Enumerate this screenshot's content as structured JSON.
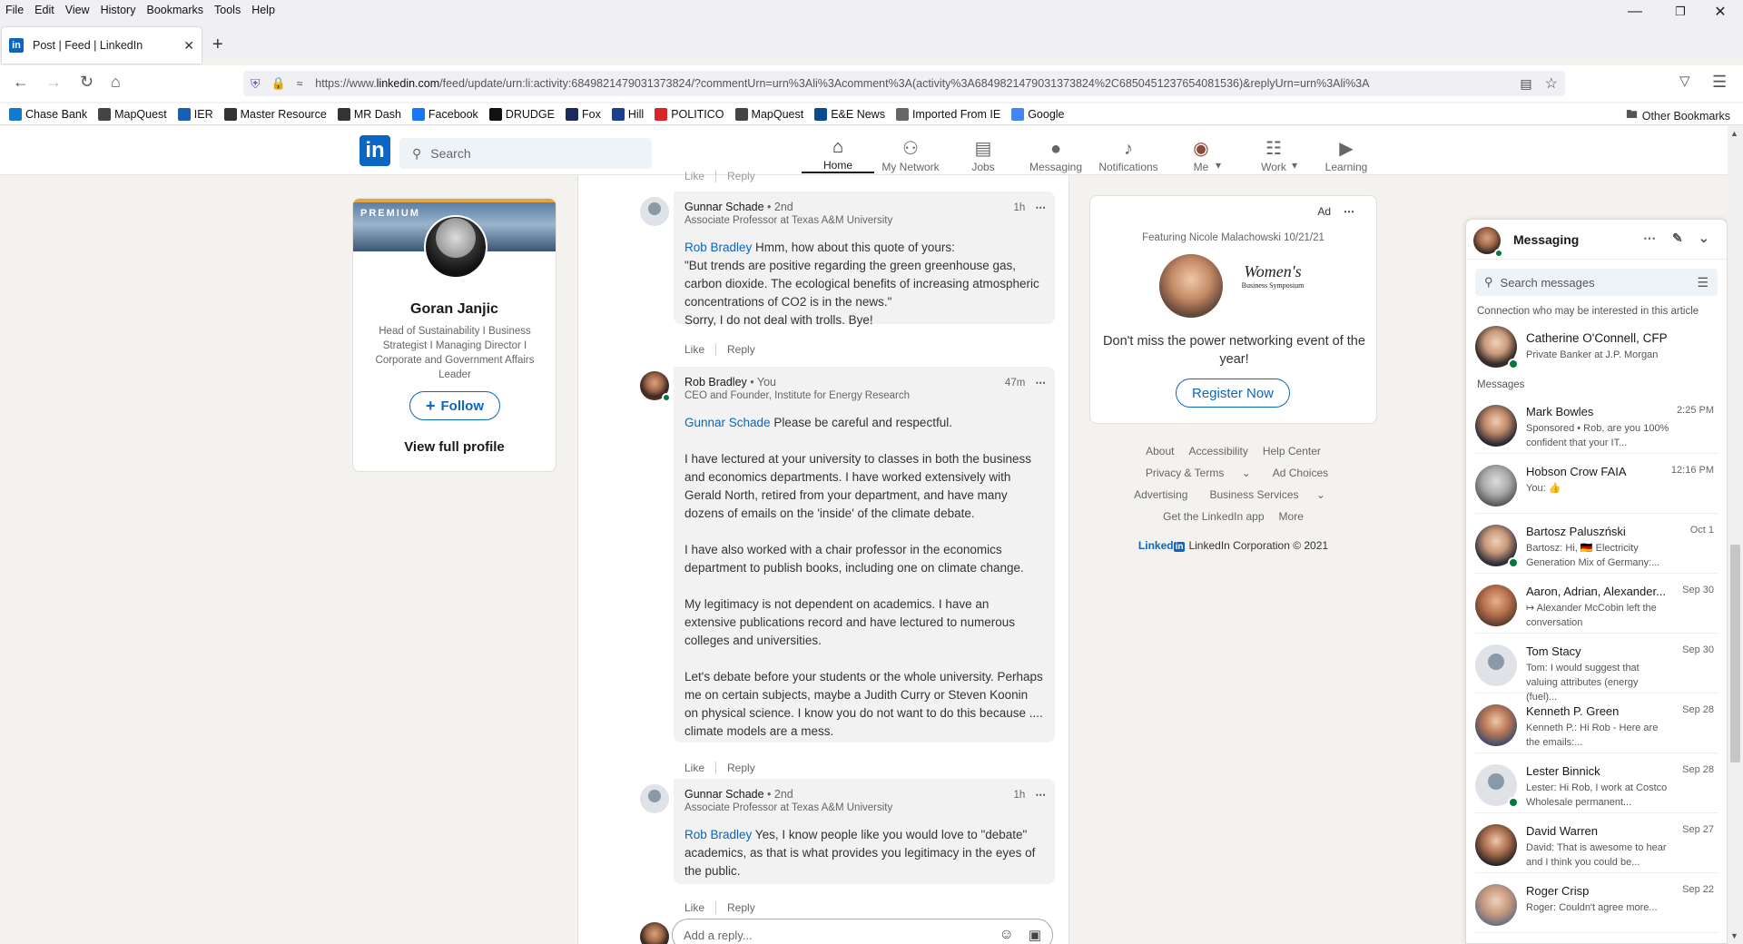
{
  "browser": {
    "menu": [
      "File",
      "Edit",
      "View",
      "History",
      "Bookmarks",
      "Tools",
      "Help"
    ],
    "tab_title": "Post | Feed | LinkedIn",
    "url_prefix": "https://www.",
    "url_domain": "linkedin.com",
    "url_rest": "/feed/update/urn:li:activity:6849821479031373824/?commentUrn=urn%3Ali%3Acomment%3A(activity%3A6849821479031373824%2C6850451237654081536)&replyUrn=urn%3Ali%3A",
    "bookmarks": [
      {
        "label": "Chase Bank",
        "icon": "chase-icon",
        "color": "#117aca"
      },
      {
        "label": "MapQuest",
        "icon": "folder-map-icon",
        "color": "#444"
      },
      {
        "label": "IER",
        "icon": "ier-icon",
        "color": "#1a5fb4"
      },
      {
        "label": "Master Resource",
        "icon": "mr-icon",
        "color": "#333"
      },
      {
        "label": "MR Dash",
        "icon": "mr-icon",
        "color": "#333"
      },
      {
        "label": "Facebook",
        "icon": "facebook-icon",
        "color": "#1877f2"
      },
      {
        "label": "DRUDGE",
        "icon": "drudge-icon",
        "color": "#111"
      },
      {
        "label": "Fox",
        "icon": "fox-icon",
        "color": "#1b2b5a"
      },
      {
        "label": "Hill",
        "icon": "hill-icon",
        "color": "#1c3f8c"
      },
      {
        "label": "POLITICO",
        "icon": "politico-icon",
        "color": "#d7262a"
      },
      {
        "label": "MapQuest",
        "icon": "folder-map-icon",
        "color": "#444"
      },
      {
        "label": "E&E News",
        "icon": "ee-icon",
        "color": "#0b4a8f"
      },
      {
        "label": "Imported From IE",
        "icon": "folder-icon",
        "color": "#666"
      },
      {
        "label": "Google",
        "icon": "google-icon",
        "color": "#4285f4"
      }
    ],
    "other_bookmarks": "Other Bookmarks"
  },
  "linkedin": {
    "search_placeholder": "Search",
    "nav": [
      {
        "label": "Home",
        "icon": "home-icon",
        "active": true
      },
      {
        "label": "My Network",
        "icon": "network-icon"
      },
      {
        "label": "Jobs",
        "icon": "jobs-icon"
      },
      {
        "label": "Messaging",
        "icon": "messaging-icon"
      },
      {
        "label": "Notifications",
        "icon": "bell-icon"
      },
      {
        "label": "Me",
        "icon": "avatar"
      },
      {
        "label": "Work",
        "icon": "grid-icon"
      },
      {
        "label": "Learning",
        "icon": "learning-icon"
      }
    ]
  },
  "profile": {
    "badge": "PREMIUM",
    "name": "Goran Janjic",
    "headline": "Head of Sustainability I Business Strategist I Managing Director I Corporate and Government Affairs Leader",
    "follow_label": "Follow",
    "view_full": "View full profile"
  },
  "comments": [
    {
      "author": "Gunnar Schade",
      "degree": "• 2nd",
      "subtitle": "Associate Professor at Texas A&M University",
      "time": "1h",
      "mention": "Rob Bradley",
      "text": " Hmm, how about this quote of yours:\n\"But trends are positive regarding the green greenhouse gas, carbon dioxide. The ecological benefits of increasing atmospheric concentrations of CO2 is in the news.\"\nSorry, I do not deal with trolls. Bye!"
    },
    {
      "author": "Rob Bradley",
      "degree": "• You",
      "subtitle": "CEO and Founder, Institute for Energy Research",
      "time": "47m",
      "mention": "Gunnar Schade",
      "text": " Please be careful and respectful.\n\nI have lectured at your university to classes in both the business and economics departments. I have worked extensively with Gerald North, retired from your department, and have many dozens of emails on the 'inside' of the climate debate.\n\nI have also worked with a chair professor in the economics department to publish books, including one on climate change.\n\nMy legitimacy is not dependent on academics. I have an extensive publications record and have lectured to numerous colleges and universities.\n\nLet's debate before your students or the whole university. Perhaps me on certain subjects, maybe a Judith Curry or Steven Koonin on physical science. I know you do not want to do this because .... climate models are a mess."
    },
    {
      "author": "Gunnar Schade",
      "degree": "• 2nd",
      "subtitle": "Associate Professor at Texas A&M University",
      "time": "1h",
      "mention": "Rob Bradley",
      "text": " Yes, I know people like you would love to \"debate\" academics, as that is what provides you legitimacy in the eyes of the public."
    }
  ],
  "comment_actions": {
    "like": "Like",
    "reply": "Reply"
  },
  "reply_placeholder": "Add a reply...",
  "ad": {
    "label": "Ad",
    "featuring": "Featuring Nicole Malachowski 10/21/21",
    "logo_title": "Women's",
    "logo_sub": "Business Symposium",
    "message": "Don't miss the power networking event of the year!",
    "cta": "Register Now"
  },
  "footer": {
    "row1": [
      "About",
      "Accessibility",
      "Help Center"
    ],
    "row2": [
      "Privacy & Terms",
      "Ad Choices"
    ],
    "row3": [
      "Advertising",
      "Business Services"
    ],
    "row4": [
      "Get the LinkedIn app",
      "More"
    ],
    "brand": "Linked",
    "corp": "LinkedIn Corporation © 2021"
  },
  "messaging": {
    "title": "Messaging",
    "search_placeholder": "Search messages",
    "suggest_label": "Connection who may be interested in this article",
    "suggest": {
      "name": "Catherine O'Connell, CFP®",
      "subtitle": "Private Banker at J.P. Morgan"
    },
    "messages_label": "Messages",
    "threads": [
      {
        "name": "Mark Bowles",
        "date": "2:25 PM",
        "preview": "Sponsored •  Rob, are you 100% confident that your IT..."
      },
      {
        "name": "Hobson Crow FAIA",
        "date": "12:16 PM",
        "preview": "You: 👍"
      },
      {
        "name": "Bartosz Paluszński",
        "date": "Oct 1",
        "preview": "Bartosz: Hi, 🇩🇪 Electricity Generation Mix of Germany:..."
      },
      {
        "name": "Aaron, Adrian, Alexander...",
        "date": "Sep 30",
        "preview": "↦ Alexander McCobin left the conversation"
      },
      {
        "name": "Tom Stacy",
        "date": "Sep 30",
        "preview": "Tom: I would suggest that valuing attributes (energy (fuel)..."
      },
      {
        "name": "Kenneth P. Green",
        "date": "Sep 28",
        "preview": "Kenneth P.: Hi Rob - Here are the emails:..."
      },
      {
        "name": "Lester Binnick",
        "date": "Sep 28",
        "preview": "Lester: Hi Rob, I work at Costco Wholesale permanent..."
      },
      {
        "name": "David Warren",
        "date": "Sep 27",
        "preview": "David: That is awesome to hear and I think you could be..."
      },
      {
        "name": "Roger Crisp",
        "date": "Sep 22",
        "preview": "Roger: Couldn't agree more..."
      }
    ]
  }
}
